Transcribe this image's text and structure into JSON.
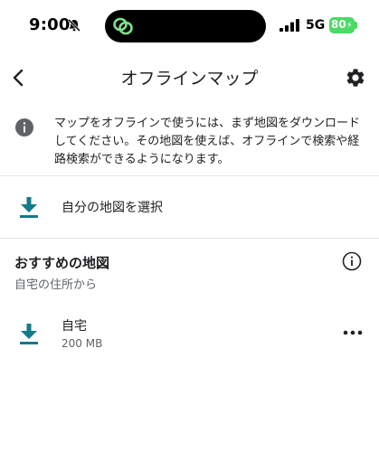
{
  "status_bar": {
    "time": "9:00",
    "network": "5G",
    "battery": "80"
  },
  "app_bar": {
    "title": "オフラインマップ",
    "back_icon": "chevron-left-icon",
    "settings_icon": "gear-icon"
  },
  "info": {
    "icon": "info-filled-icon",
    "text": "マップをオフラインで使うには、まず地図をダウンロードしてください。その地図を使えば、オフラインで検索や経路検索ができるようになります。"
  },
  "select_map": {
    "icon": "download-icon",
    "label": "自分の地図を選択"
  },
  "recommended": {
    "title": "おすすめの地図",
    "subtitle": "自宅の住所から",
    "info_icon": "info-outline-icon",
    "items": [
      {
        "title": "自宅",
        "size": "200 MB",
        "icon": "download-icon",
        "menu_icon": "more-horizontal-icon"
      }
    ]
  },
  "colors": {
    "accent": "#137a8a",
    "battery": "#4cd964",
    "text": "#202124",
    "secondary_text": "#5f6368",
    "divider": "#e4e4e4"
  }
}
